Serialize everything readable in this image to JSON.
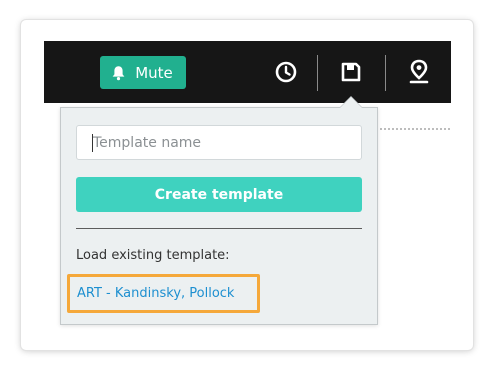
{
  "toolbar": {
    "mute_label": "Mute",
    "icons": [
      "bell-icon",
      "clock-icon",
      "save-icon",
      "location-pin-icon"
    ]
  },
  "template_popover": {
    "name_placeholder": "Template name",
    "name_value": "",
    "create_button_label": "Create template",
    "load_existing_label": "Load existing template:",
    "existing_templates": [
      "ART - Kandinsky, Pollock"
    ]
  },
  "colors": {
    "topbar_background": "#161616",
    "mute_button": "#21b08f",
    "create_button": "#3fd2bf",
    "popover_background": "#ecf0f1",
    "link": "#1d8fd0",
    "highlight_outline": "#f5a83a"
  }
}
